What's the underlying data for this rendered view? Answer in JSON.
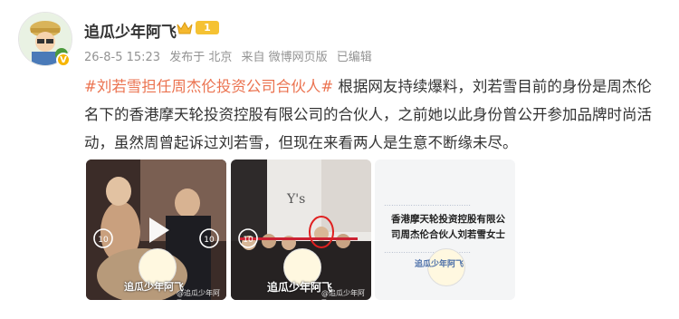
{
  "user": {
    "name": "追瓜少年阿飞",
    "level_badge": "1",
    "verified_badge": "V"
  },
  "meta": {
    "date": "26-8-5 15:23",
    "posted_from": "发布于 北京",
    "source": "来自 微博网页版",
    "edited": "已编辑"
  },
  "post": {
    "topic": "#刘若雪担任周杰伦投资公司合伙人#",
    "body": " 根据网友持续爆料，刘若雪目前的身份是周杰伦名下的香港摩天轮投资控股有限公司的合伙人，之前她以此身份曾公开参加品牌时尚活动，虽然周曾起诉过刘若雪，但现在来看两人是生意不断缘未尽。"
  },
  "media": [
    {
      "type": "video",
      "counter": "10",
      "watermark": "@追瓜少年阿飞",
      "logo_text": "追瓜少年阿飞"
    },
    {
      "type": "video",
      "counter": "10",
      "watermark": "@追瓜少年阿飞",
      "logo_text": "追瓜少年阿飞"
    },
    {
      "type": "image",
      "text": "香港摩天轮投资控股有限公司周杰伦合伙人刘若雪女士",
      "logo_text": "追瓜少年阿飞"
    }
  ],
  "colors": {
    "topic": "#eb7350",
    "meta": "#939393",
    "level": "#f5c233"
  }
}
